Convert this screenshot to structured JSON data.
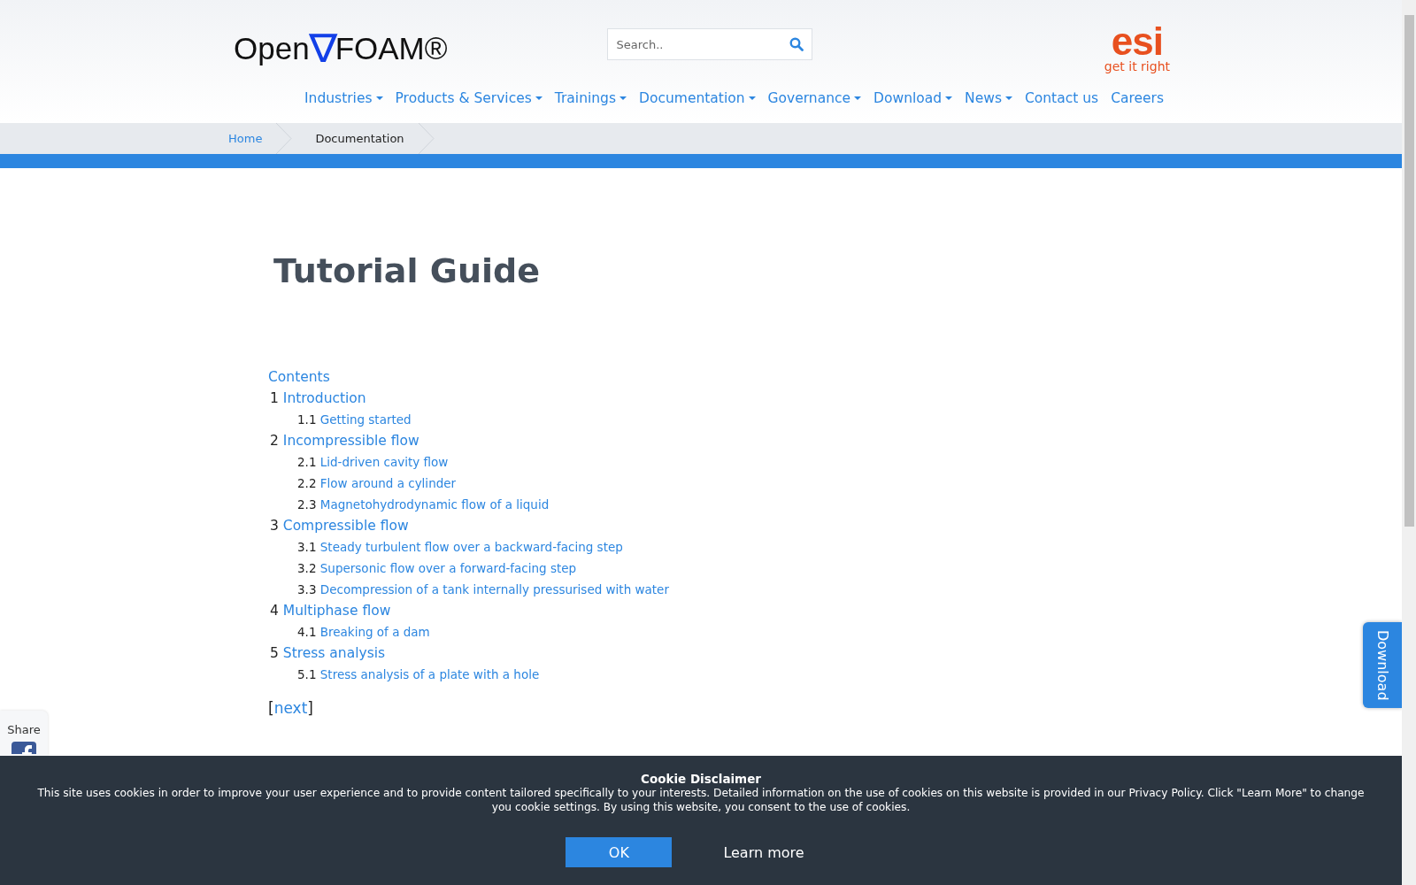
{
  "header": {
    "logo": {
      "left": "Open",
      "nabla": "∇",
      "right": "FOAM®"
    },
    "search": {
      "placeholder": "Search.."
    },
    "brand": {
      "mark": "esi",
      "tagline": "get it right"
    }
  },
  "nav": [
    {
      "label": "Industries",
      "dropdown": true
    },
    {
      "label": "Products & Services",
      "dropdown": true
    },
    {
      "label": "Trainings",
      "dropdown": true
    },
    {
      "label": "Documentation",
      "dropdown": true
    },
    {
      "label": "Governance",
      "dropdown": true
    },
    {
      "label": "Download",
      "dropdown": true
    },
    {
      "label": "News",
      "dropdown": true
    },
    {
      "label": "Contact us",
      "dropdown": false
    },
    {
      "label": "Careers",
      "dropdown": false
    }
  ],
  "breadcrumb": [
    {
      "label": "Home",
      "selected": false
    },
    {
      "label": "Documentation",
      "selected": true
    }
  ],
  "title": "Tutorial Guide",
  "contents": {
    "heading": "Contents",
    "sections": [
      {
        "number": "1",
        "title": "Introduction",
        "children": [
          {
            "number": "1.1",
            "title": "Getting started"
          }
        ]
      },
      {
        "number": "2",
        "title": "Incompressible flow",
        "children": [
          {
            "number": "2.1",
            "title": "Lid-driven cavity flow"
          },
          {
            "number": "2.2",
            "title": "Flow around a cylinder"
          },
          {
            "number": "2.3",
            "title": "Magnetohydrodynamic flow of a liquid"
          }
        ]
      },
      {
        "number": "3",
        "title": "Compressible flow",
        "children": [
          {
            "number": "3.1",
            "title": "Steady turbulent flow over a backward-facing step"
          },
          {
            "number": "3.2",
            "title": "Supersonic flow over a forward-facing step"
          },
          {
            "number": "3.3",
            "title": "Decompression of a tank internally pressurised with water"
          }
        ]
      },
      {
        "number": "4",
        "title": "Multiphase flow",
        "children": [
          {
            "number": "4.1",
            "title": "Breaking of a dam"
          }
        ]
      },
      {
        "number": "5",
        "title": "Stress analysis",
        "children": [
          {
            "number": "5.1",
            "title": "Stress analysis of a plate with a hole"
          }
        ]
      }
    ]
  },
  "pager": {
    "open": "[",
    "link": "next",
    "close": "]"
  },
  "share": {
    "label": "Share"
  },
  "download_tab": "Download",
  "cookie": {
    "title": "Cookie Disclaimer",
    "text": "This site uses cookies in order to improve your user experience and to provide content tailored specifically to your interests. Detailed information on the use of cookies on this website is provided in our Privacy Policy. Click \"Learn More\" to change you cookie settings. By using this website, you consent to the use of cookies.",
    "ok": "OK",
    "learn": "Learn more"
  }
}
